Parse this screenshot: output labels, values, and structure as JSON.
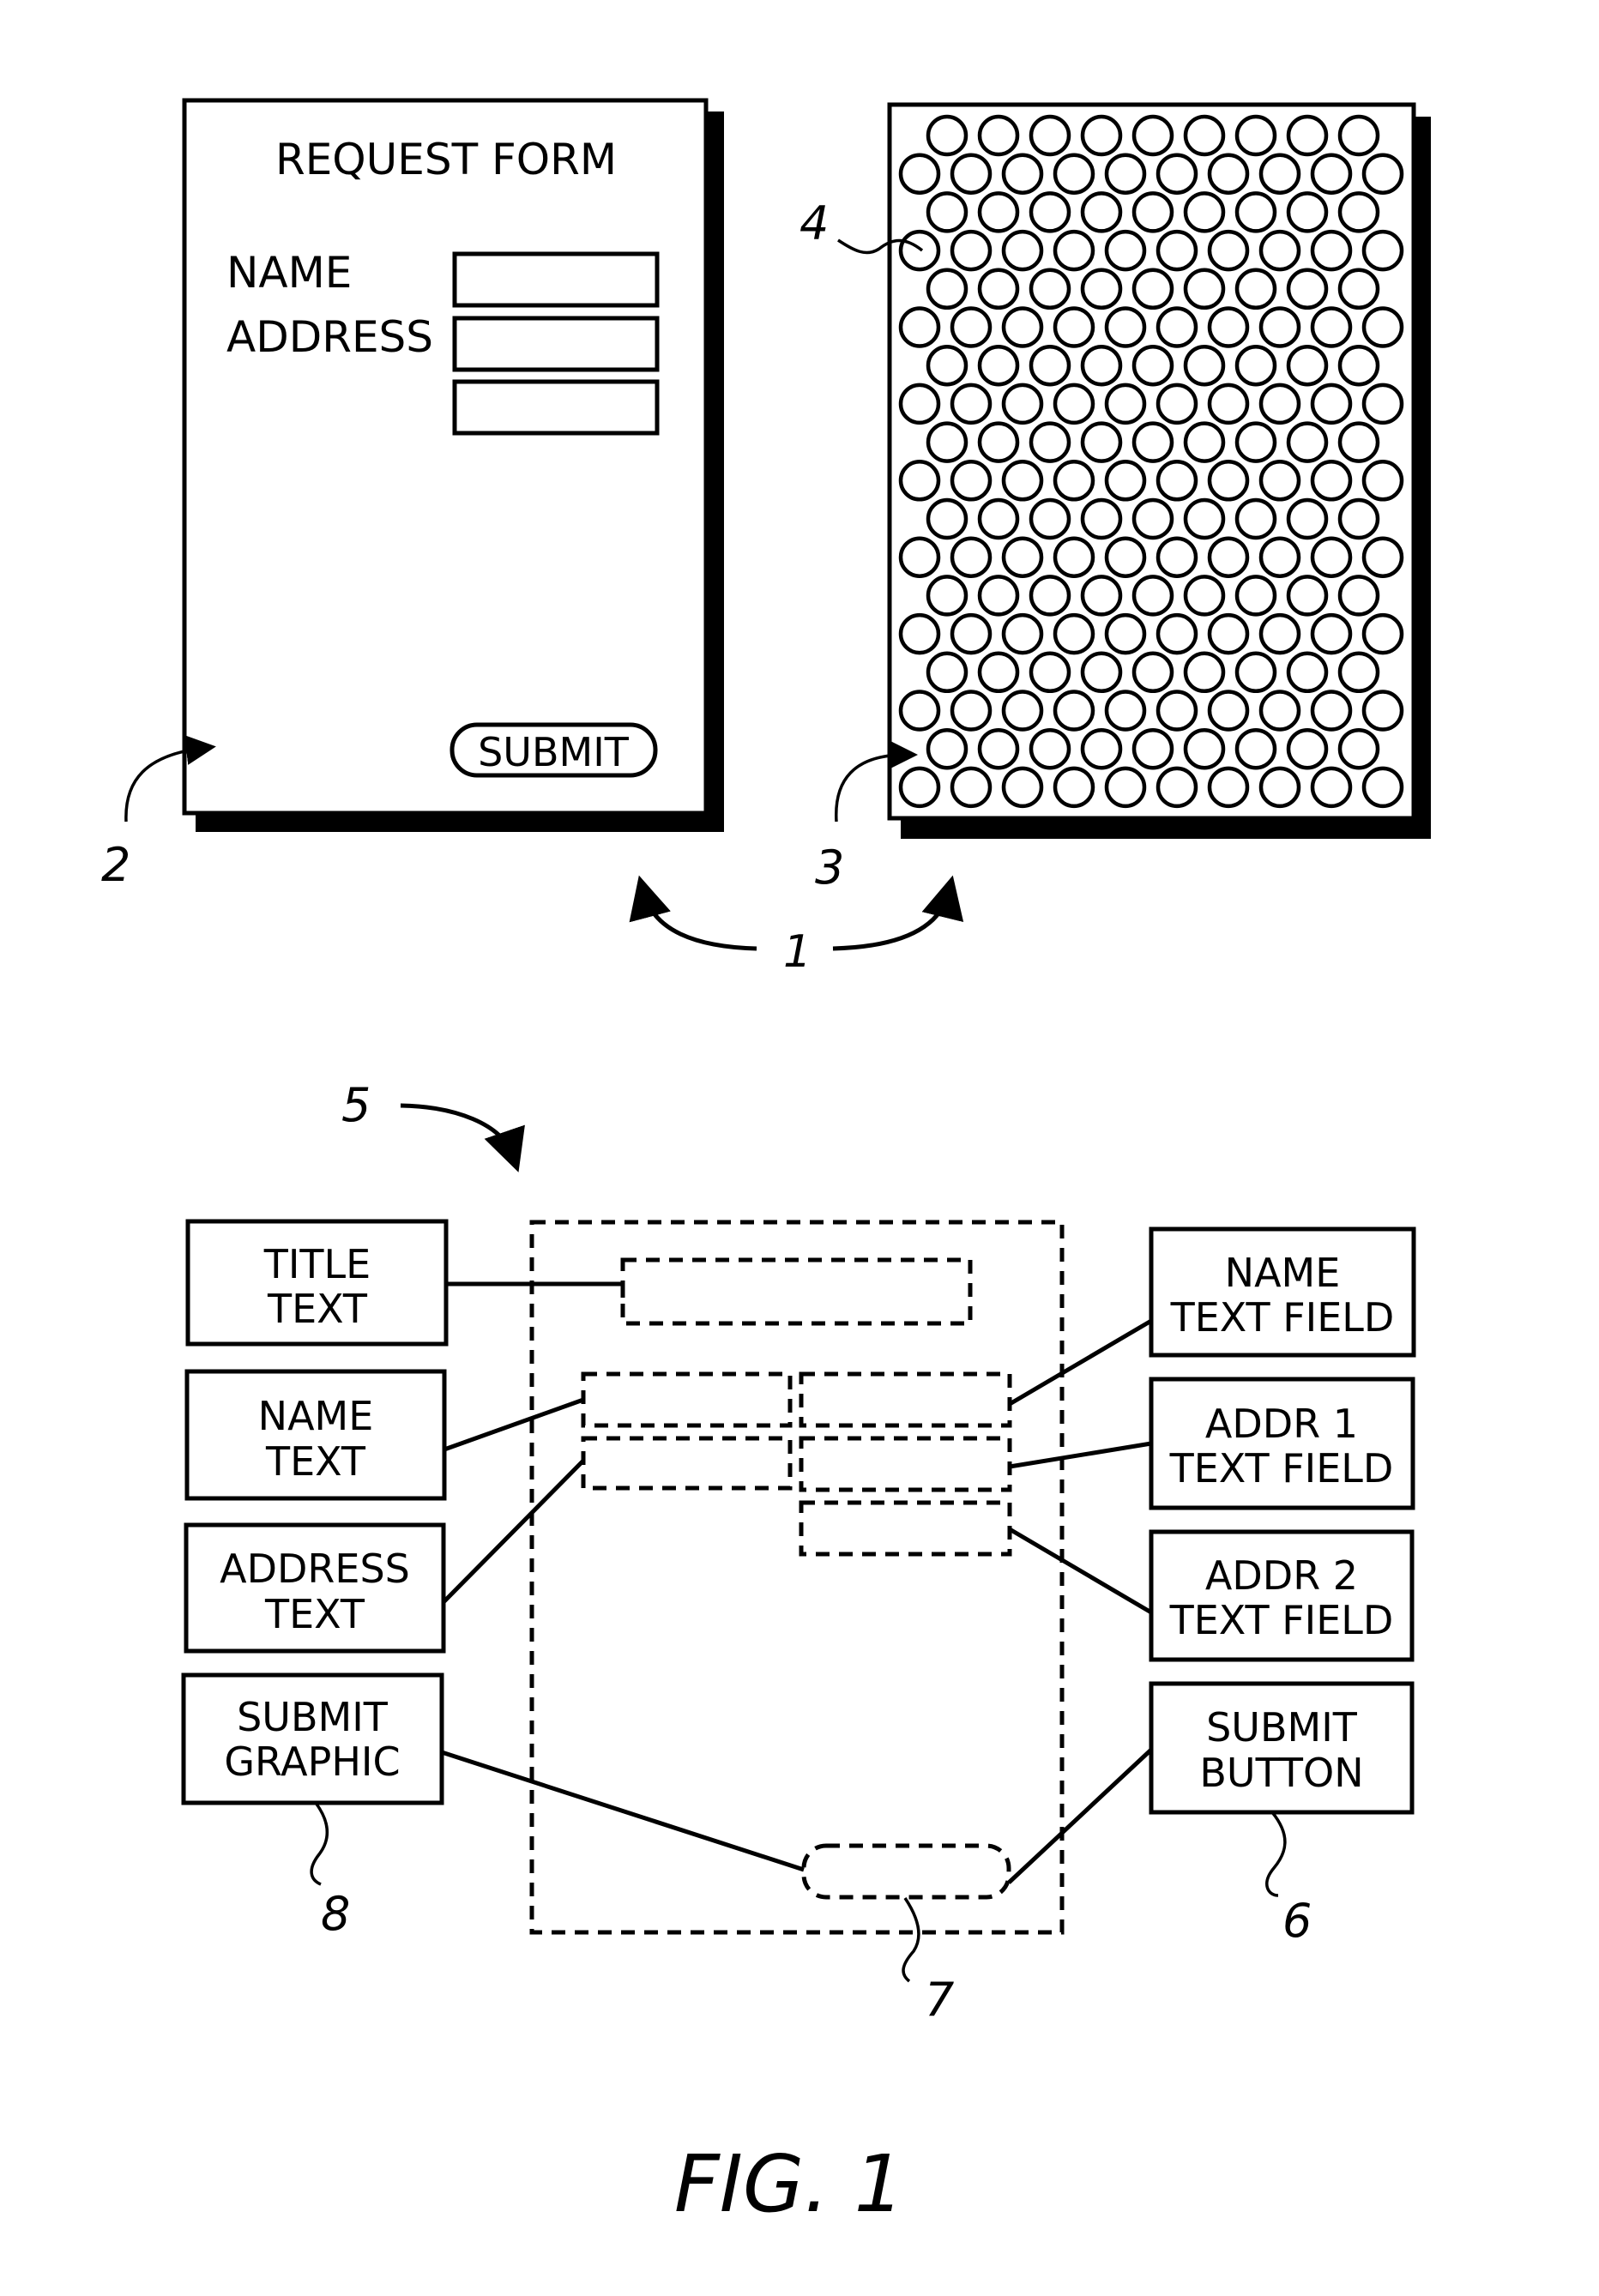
{
  "figure": {
    "caption": "FIG. 1",
    "reference_numerals": {
      "system": "1",
      "form_page": "2",
      "coded_pattern_page": "3",
      "tag": "4",
      "page_description": "5",
      "submit_button_element": "6",
      "submit_zone": "7",
      "submit_graphic_element": "8"
    }
  },
  "form_page": {
    "title": "REQUEST FORM",
    "fields": [
      {
        "label": "NAME"
      },
      {
        "label": "ADDRESS"
      },
      {
        "label": ""
      }
    ],
    "submit_label": "SUBMIT"
  },
  "coded_pattern": {
    "rows": 18,
    "row_pattern": [
      9,
      10
    ],
    "tag_shape": "circle"
  },
  "page_description": {
    "left_elements": [
      {
        "line1": "TITLE",
        "line2": "TEXT"
      },
      {
        "line1": "NAME",
        "line2": "TEXT"
      },
      {
        "line1": "ADDRESS",
        "line2": "TEXT"
      },
      {
        "line1": "SUBMIT",
        "line2": "GRAPHIC"
      }
    ],
    "right_elements": [
      {
        "line1": "NAME",
        "line2": "TEXT FIELD"
      },
      {
        "line1": "ADDR 1",
        "line2": "TEXT FIELD"
      },
      {
        "line1": "ADDR 2",
        "line2": "TEXT FIELD"
      },
      {
        "line1": "SUBMIT",
        "line2": "BUTTON"
      }
    ]
  }
}
